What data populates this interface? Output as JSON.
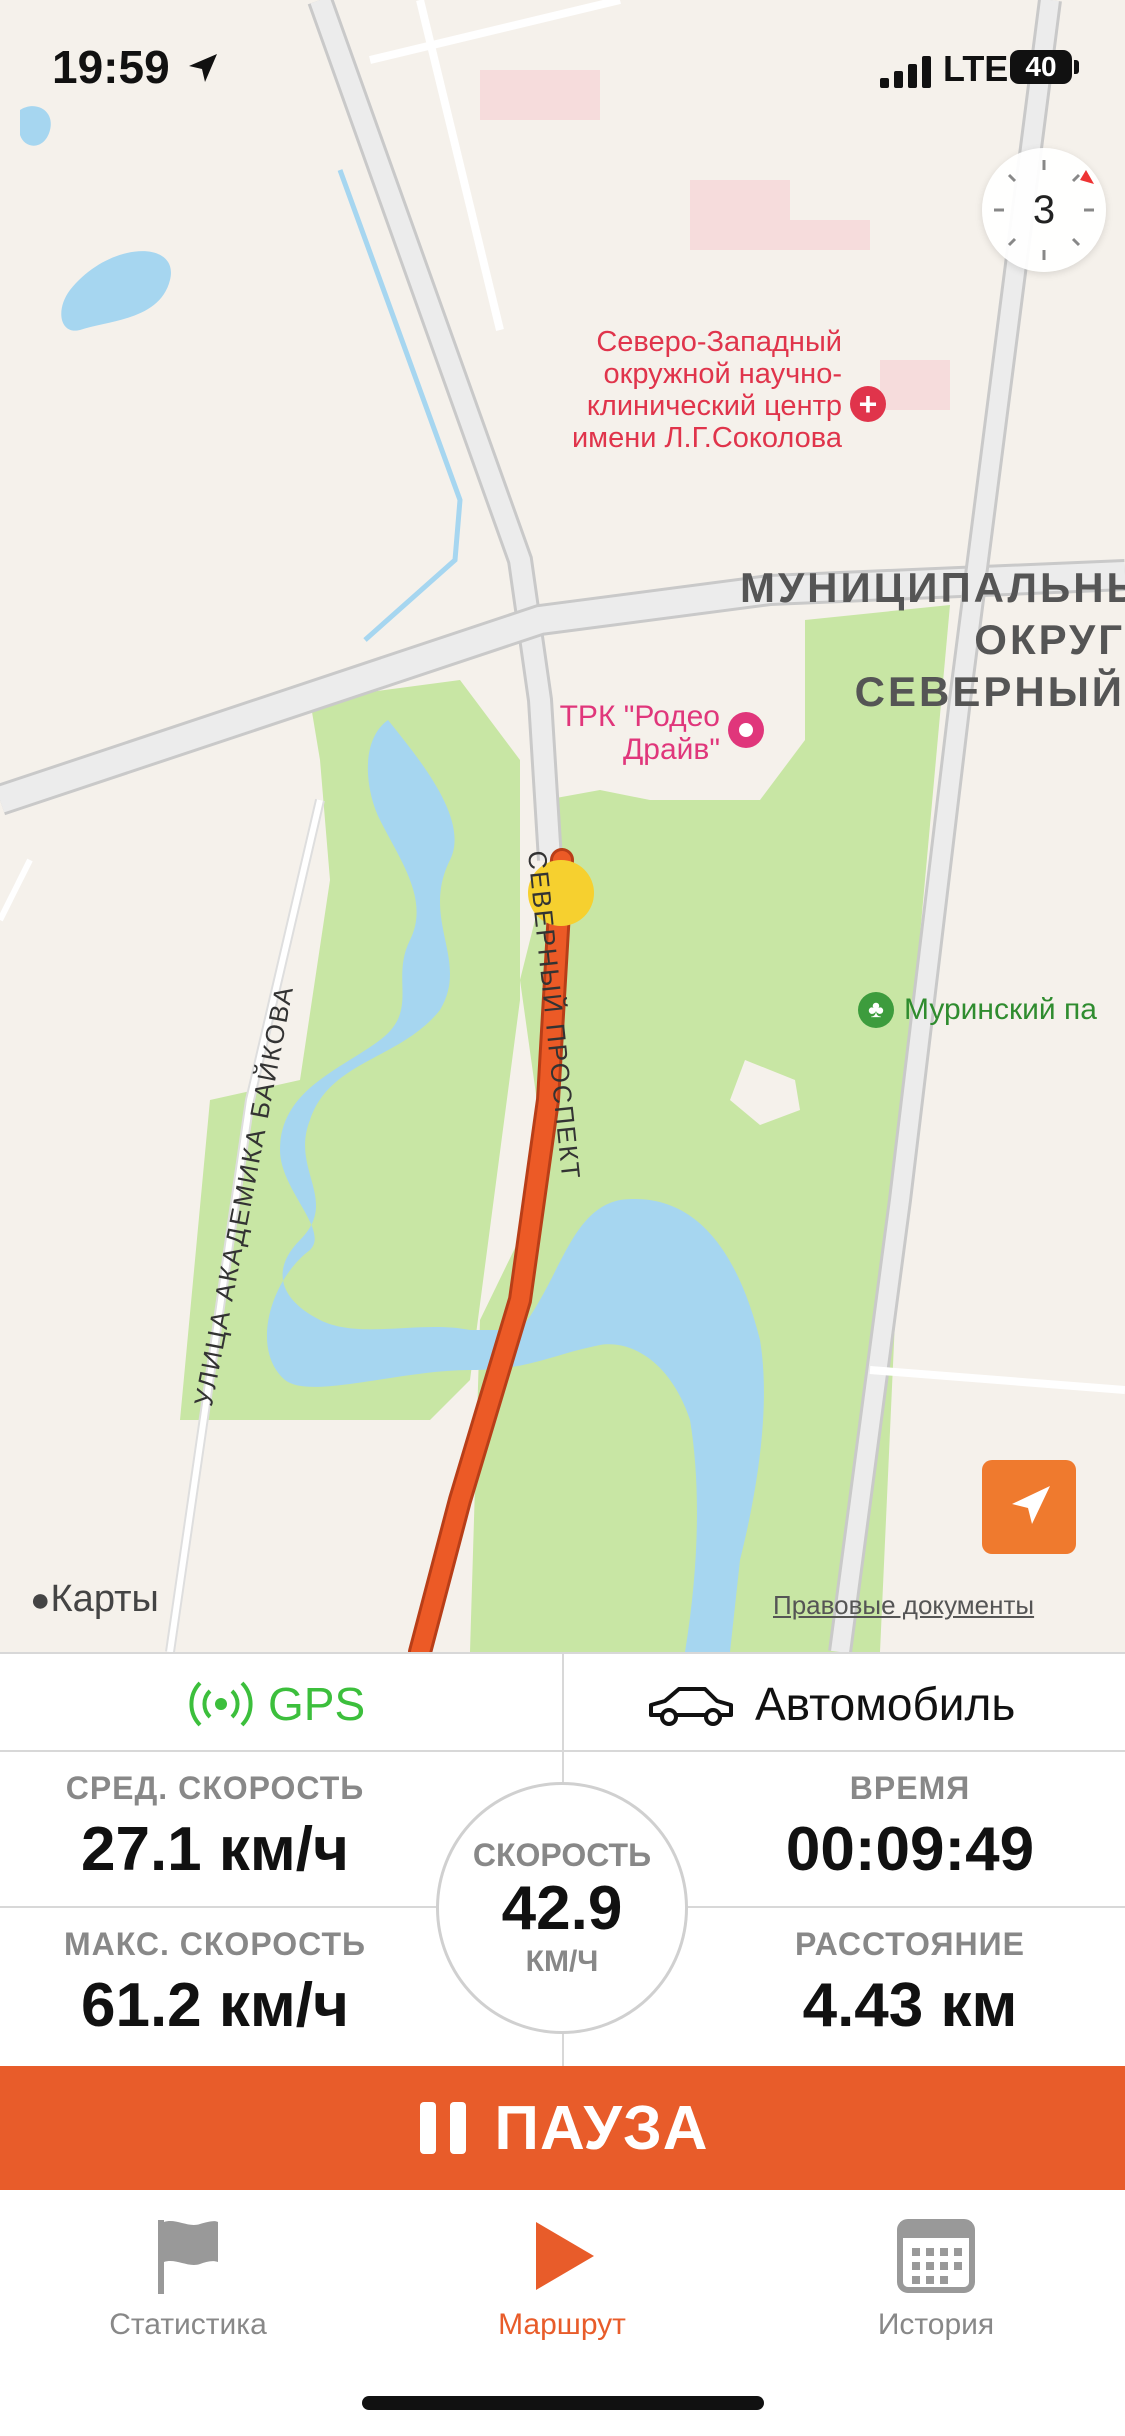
{
  "status_bar": {
    "time": "19:59",
    "network": "LTE",
    "battery": "40"
  },
  "map": {
    "compass_value": "3",
    "labels": {
      "hospital": "Северо-Западный окружной научно-клинический центр имени Л.Г.Соколова",
      "district": "МУНИЦИПАЛЬНЫЙ ОКРУГ СЕВЕРНЫЙ",
      "mall": "ТРК \"Родео Драйв\"",
      "park": "Муринский па",
      "street_main": "СЕВЕРНЫЙ ПРОСПЕКТ",
      "street_side": "УЛИЦА АКАДЕМИКА БАЙКОВА"
    },
    "attribution": "Карты",
    "legal": "Правовые документы"
  },
  "stats": {
    "gps_label": "GPS",
    "vehicle_label": "Автомобиль",
    "avg_speed_label": "СРЕД. СКОРОСТЬ",
    "avg_speed_value": "27.1 км/ч",
    "time_label": "ВРЕМЯ",
    "time_value": "00:09:49",
    "max_speed_label": "МАКС. СКОРОСТЬ",
    "max_speed_value": "61.2 км/ч",
    "distance_label": "РАССТОЯНИЕ",
    "distance_value": "4.43 км",
    "speed_label": "СКОРОСТЬ",
    "speed_value": "42.9",
    "speed_unit": "КМ/Ч"
  },
  "pause_button": {
    "label": "ПАУЗА"
  },
  "tabs": [
    {
      "label": "Статистика",
      "icon": "flag-icon",
      "active": false
    },
    {
      "label": "Маршрут",
      "icon": "play-icon",
      "active": true
    },
    {
      "label": "История",
      "icon": "calendar-icon",
      "active": false
    }
  ],
  "colors": {
    "accent": "#e85c2a",
    "gps_green": "#3cbf3c",
    "park_green": "#c8e6a4",
    "water": "#a6d6f0",
    "map_bg": "#f5f1eb"
  }
}
